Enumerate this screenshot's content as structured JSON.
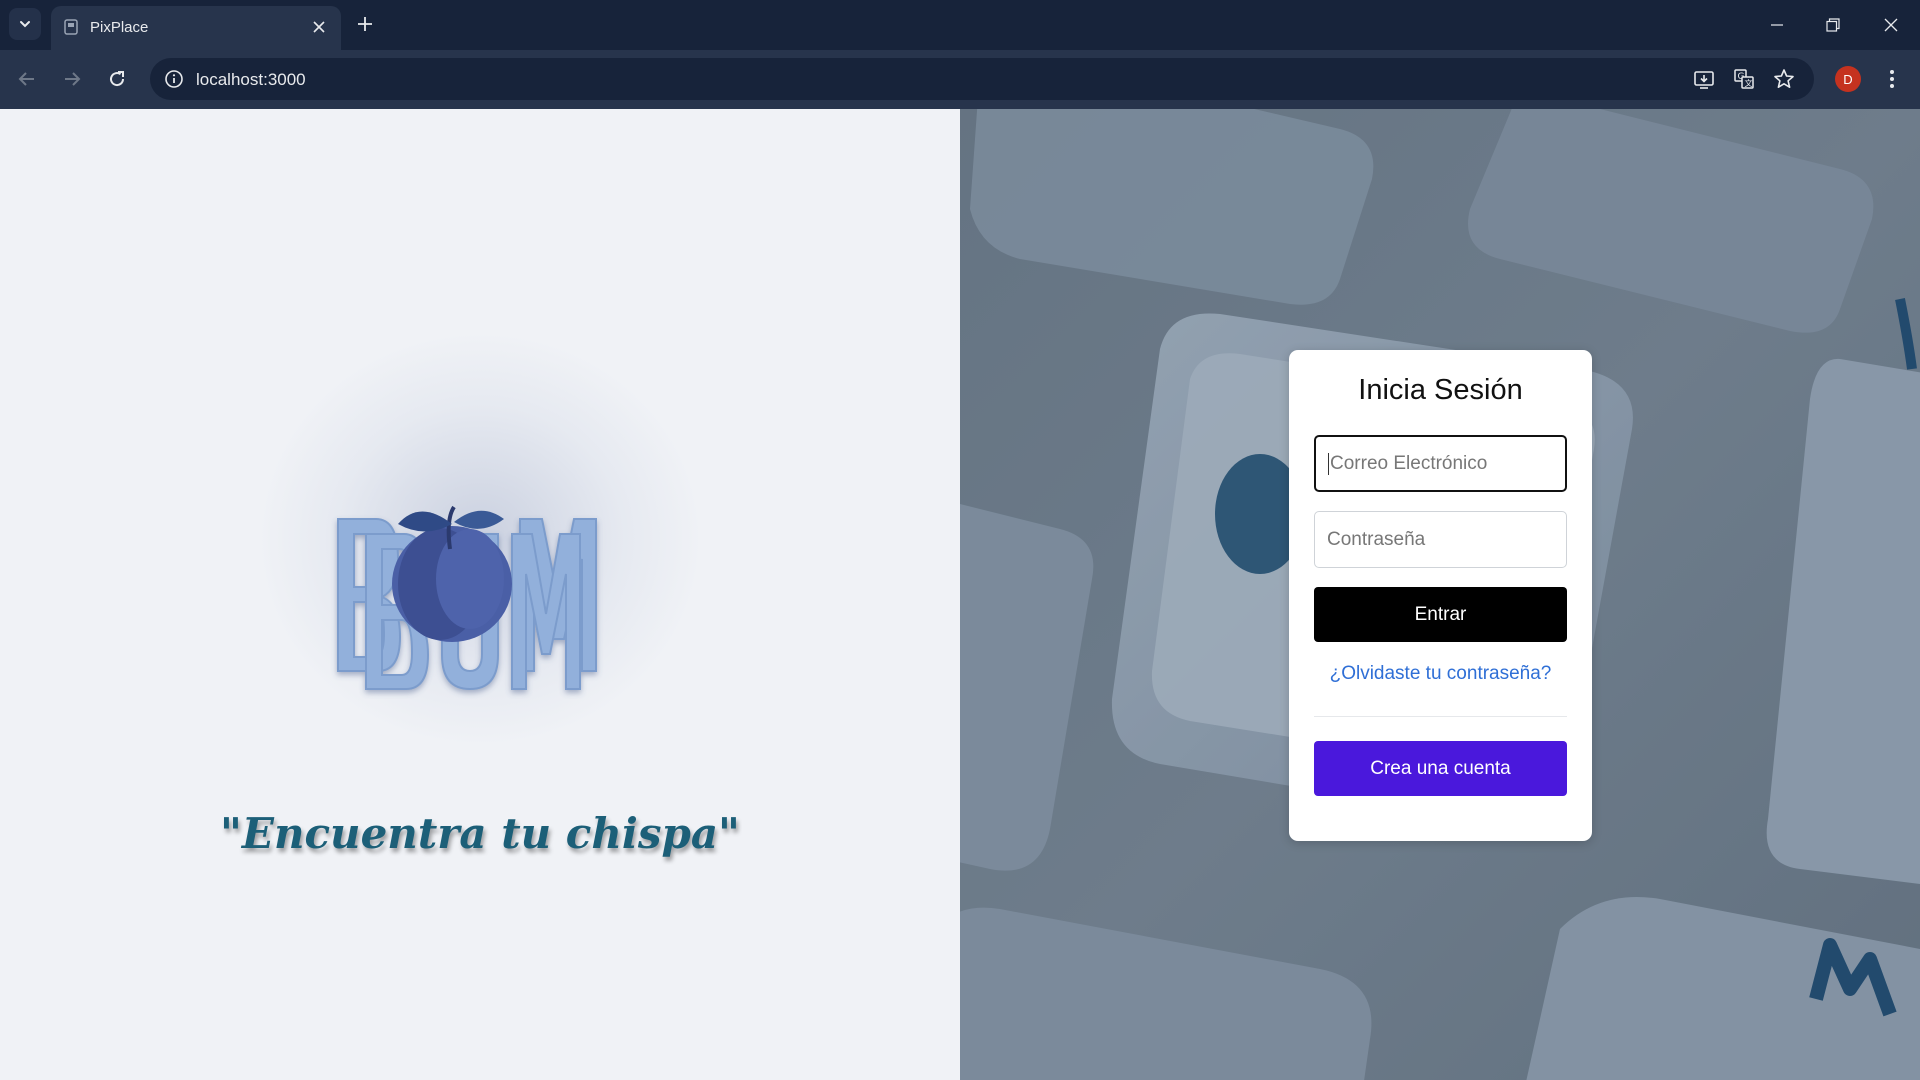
{
  "browser": {
    "tab_title": "PixPlace",
    "url": "localhost:3000",
    "profile_initial": "D",
    "profile_color": "#c5321f"
  },
  "left": {
    "logo_alt": "BOOM BUM",
    "tagline": "\"Encuentra tu chispa\""
  },
  "login": {
    "title": "Inicia Sesión",
    "email_placeholder": "Correo Electrónico",
    "password_placeholder": "Contraseña",
    "submit_label": "Entrar",
    "forgot_label": "¿Olvidaste tu contraseña?",
    "create_label": "Crea una cuenta"
  },
  "colors": {
    "accent_purple": "#4a18dc",
    "link_blue": "#2f6fd6",
    "tagline_teal": "#1c5f78"
  }
}
